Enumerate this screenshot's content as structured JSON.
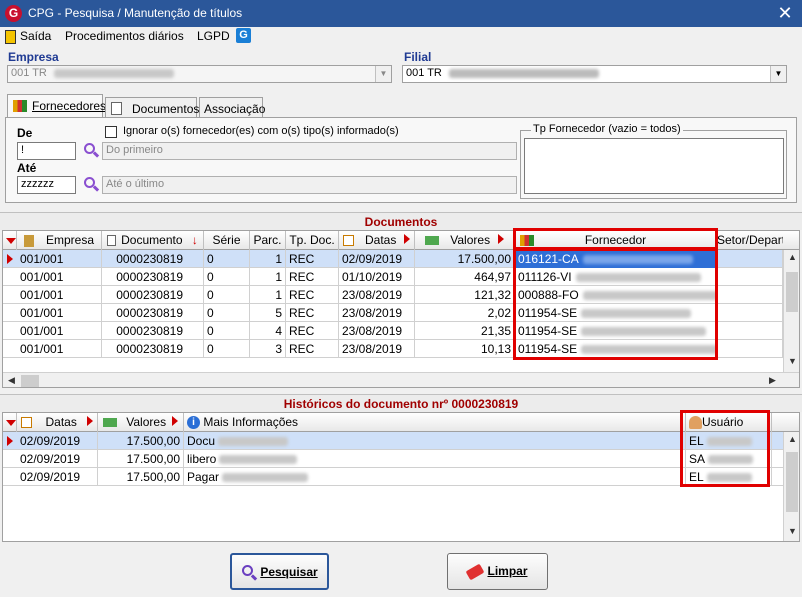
{
  "window": {
    "title": "CPG - Pesquisa / Manutenção de títulos",
    "close_glyph": "✕"
  },
  "menu": {
    "items": [
      "Saída",
      "Procedimentos diários",
      "LGPD"
    ]
  },
  "empresa": {
    "label": "Empresa",
    "value": "001 TR"
  },
  "filial": {
    "label": "Filial",
    "value": "001 TR"
  },
  "tabs": [
    "Fornecedores",
    "Documentos",
    "Associação"
  ],
  "filtro": {
    "de_label": "De",
    "de_value": "!",
    "ate_label": "Até",
    "ate_value": "zzzzzz",
    "de_placeholder": "Do primeiro",
    "ate_placeholder": "Até o último",
    "ignorar_label": "Ignorar o(s) fornecedor(es) com o(s) tipo(s) informado(s)",
    "tp_fornecedor_label": "Tp Fornecedor (vazio = todos)"
  },
  "documentos": {
    "header": "Documentos",
    "columns": [
      "Empresa",
      "Documento",
      "Série",
      "Parc.",
      "Tp. Doc.",
      "Datas",
      "Valores",
      "Fornecedor",
      "Setor/Depart"
    ],
    "rows": [
      {
        "empresa": "001/001",
        "documento": "0000230819",
        "serie": "0",
        "parc": "1",
        "tp": "REC",
        "data": "02/09/2019",
        "valor": "17.500,00",
        "fornecedor": "016121-CA"
      },
      {
        "empresa": "001/001",
        "documento": "0000230819",
        "serie": "0",
        "parc": "1",
        "tp": "REC",
        "data": "01/10/2019",
        "valor": "464,97",
        "fornecedor": "011126-VI"
      },
      {
        "empresa": "001/001",
        "documento": "0000230819",
        "serie": "0",
        "parc": "1",
        "tp": "REC",
        "data": "23/08/2019",
        "valor": "121,32",
        "fornecedor": "000888-FO"
      },
      {
        "empresa": "001/001",
        "documento": "0000230819",
        "serie": "0",
        "parc": "5",
        "tp": "REC",
        "data": "23/08/2019",
        "valor": "2,02",
        "fornecedor": "011954-SE"
      },
      {
        "empresa": "001/001",
        "documento": "0000230819",
        "serie": "0",
        "parc": "4",
        "tp": "REC",
        "data": "23/08/2019",
        "valor": "21,35",
        "fornecedor": "011954-SE"
      },
      {
        "empresa": "001/001",
        "documento": "0000230819",
        "serie": "0",
        "parc": "3",
        "tp": "REC",
        "data": "23/08/2019",
        "valor": "10,13",
        "fornecedor": "011954-SE"
      }
    ]
  },
  "historicos": {
    "header": "Históricos do documento nrº 0000230819",
    "columns": [
      "Datas",
      "Valores",
      "Mais Informações",
      "Usuário"
    ],
    "rows": [
      {
        "data": "02/09/2019",
        "valor": "17.500,00",
        "info": "Docu",
        "usuario": "EL"
      },
      {
        "data": "02/09/2019",
        "valor": "17.500,00",
        "info": "libero",
        "usuario": "SA"
      },
      {
        "data": "02/09/2019",
        "valor": "17.500,00",
        "info": "Pagar",
        "usuario": "EL"
      }
    ]
  },
  "buttons": {
    "pesquisar": "Pesquisar",
    "limpar": "Limpar"
  },
  "colors": {
    "titlebar": "#2b579a",
    "section_title": "#a00000",
    "selection": "#2f6fd6",
    "highlight_box": "#e00000"
  }
}
